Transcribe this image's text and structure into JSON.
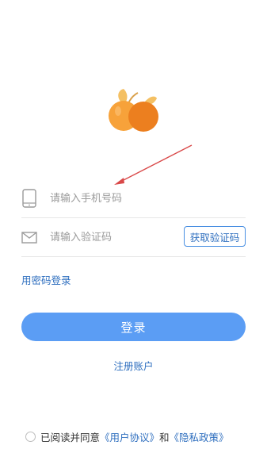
{
  "app": {
    "logo_icon": "orange-fruit-logo",
    "logo_colors": {
      "fruit_light": "#f7a23a",
      "fruit_dark": "#ec7f1f",
      "leaf": "#f4c063"
    }
  },
  "annotation": {
    "arrow_color": "#d94848"
  },
  "login_form": {
    "phone": {
      "icon": "phone-icon",
      "placeholder": "请输入手机号码",
      "value": ""
    },
    "code": {
      "icon": "mail-icon",
      "placeholder": "请输入验证码",
      "value": "",
      "get_code_label": "获取验证码"
    },
    "password_login_label": "用密码登录",
    "submit_label": "登录",
    "register_label": "注册账户",
    "accent_color": "#5b9df4",
    "link_color": "#2f6fbf"
  },
  "agreement": {
    "checked": false,
    "prefix": "已阅读并同意",
    "user_agreement_label": "《用户协议》",
    "and": "和",
    "privacy_label": "《隐私政策》"
  }
}
